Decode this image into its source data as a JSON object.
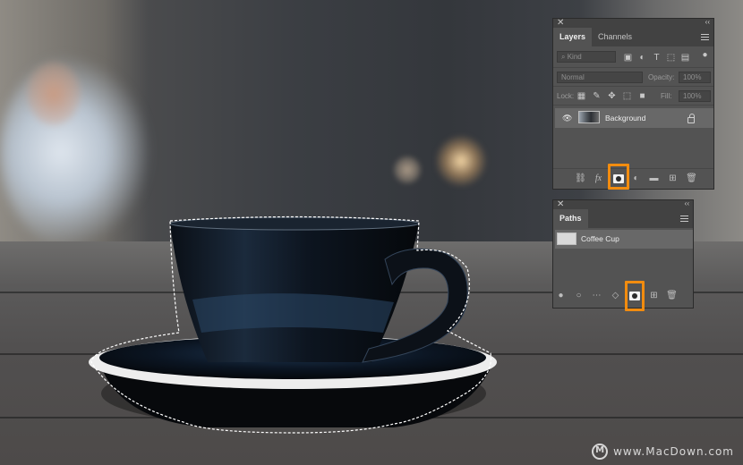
{
  "layers_panel": {
    "close_glyph": "✕",
    "collapse_glyph": "‹‹",
    "tabs": [
      {
        "label": "Layers",
        "active": true
      },
      {
        "label": "Channels",
        "active": false
      }
    ],
    "filter_kind": "Kind",
    "blend_mode": "Normal",
    "opacity_label": "Opacity:",
    "opacity_value": "100%",
    "lock_label": "Lock:",
    "fill_label": "Fill:",
    "fill_value": "100%",
    "layers": [
      {
        "name": "Background",
        "visible": true,
        "locked": true
      }
    ],
    "footer_icons": [
      "link-icon",
      "fx-icon",
      "add-mask-icon",
      "adjustment-icon",
      "folder-icon",
      "new-layer-icon",
      "trash-icon"
    ],
    "fx_glyph": "fx",
    "highlighted": "add-mask-icon"
  },
  "paths_panel": {
    "close_glyph": "✕",
    "collapse_glyph": "‹‹",
    "tabs": [
      {
        "label": "Paths",
        "active": true
      }
    ],
    "paths": [
      {
        "name": "Coffee Cup"
      }
    ],
    "footer_icons": [
      "fill-path-icon",
      "stroke-path-icon",
      "load-selection-icon",
      "make-work-path-icon",
      "add-mask-icon",
      "new-path-icon",
      "trash-icon"
    ],
    "highlighted": "add-mask-icon"
  },
  "watermark": "www.MacDown.com",
  "colors": {
    "highlight": "#f28c0f",
    "panel_bg": "#535353",
    "panel_header": "#424242"
  }
}
